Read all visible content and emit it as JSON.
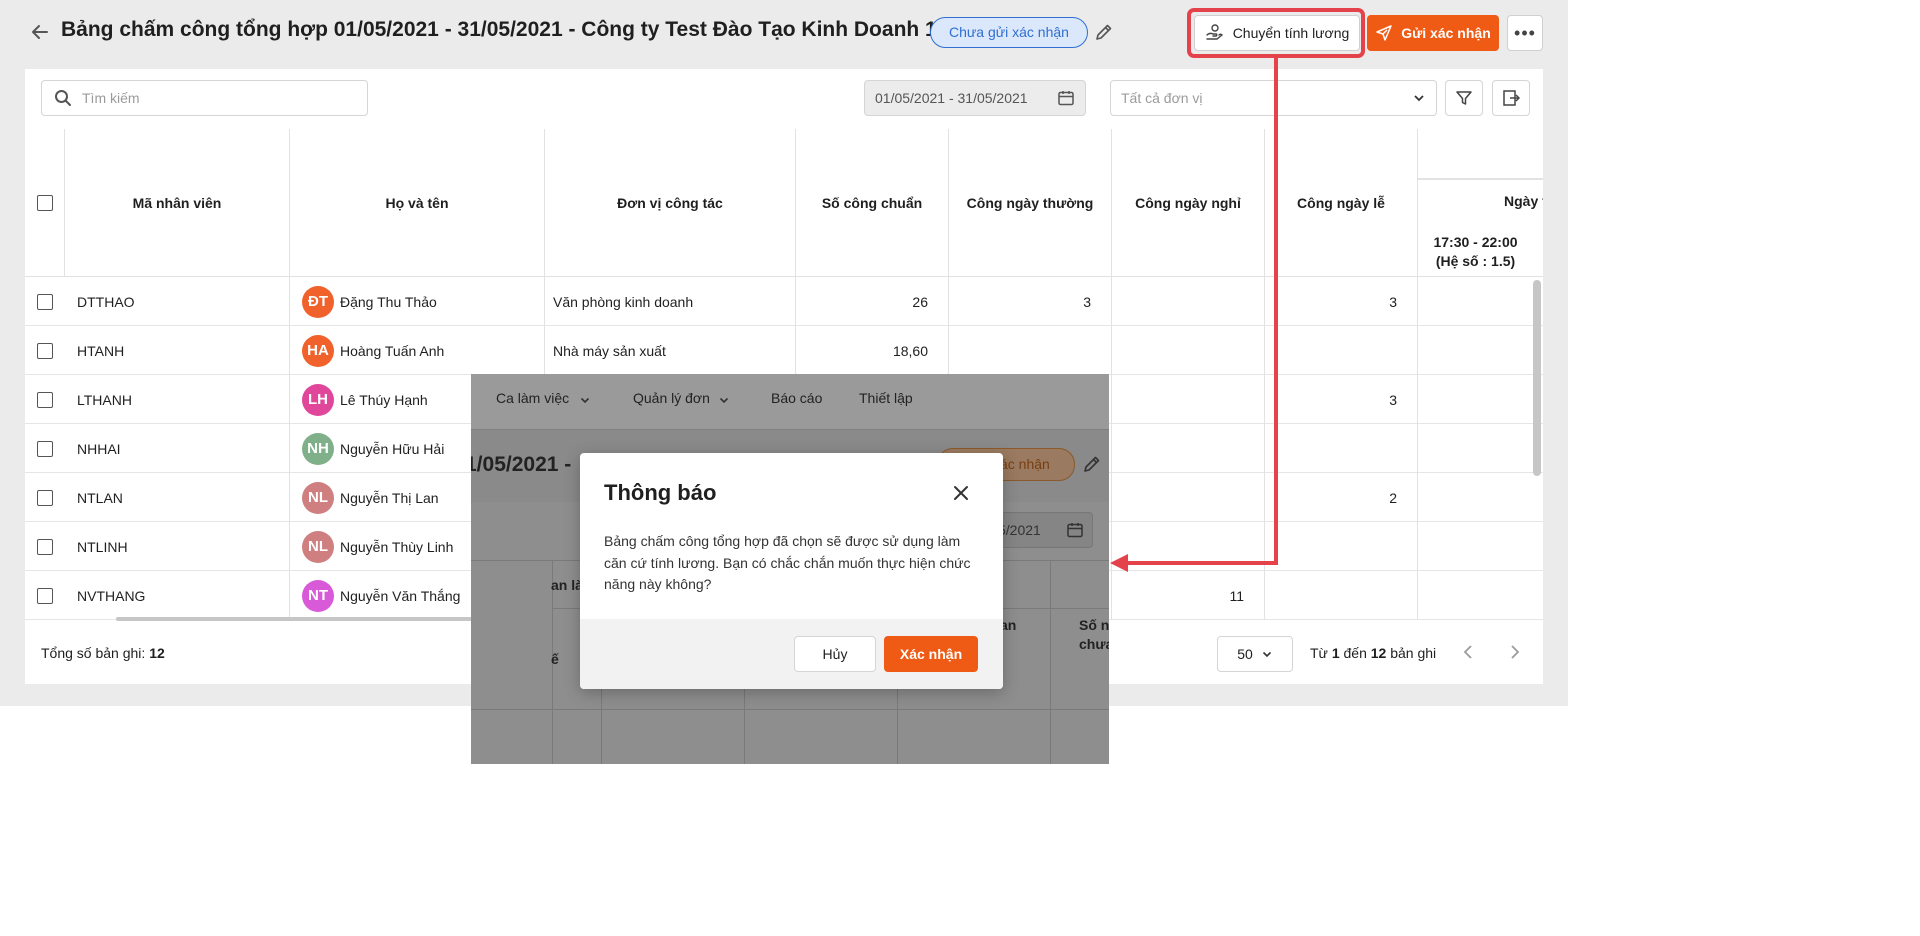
{
  "header": {
    "title": "Bảng chấm công tổng hợp 01/05/2021 - 31/05/2021 - Công ty Test Đào Tạo Kinh Doanh 1",
    "status": "Chưa gửi xác nhận",
    "transfer_label": "Chuyển tính lương",
    "send_label": "Gửi xác nhận",
    "more_label": "•••"
  },
  "toolbar": {
    "search_placeholder": "Tìm kiếm",
    "date_range": "01/05/2021 - 31/05/2021",
    "unit_placeholder": "Tất cả đơn vị"
  },
  "table": {
    "columns": [
      "Mã nhân viên",
      "Họ và tên",
      "Đơn vị công tác",
      "Số công chuẩn",
      "Công ngày thường",
      "Công ngày nghỉ",
      "Công ngày lễ"
    ],
    "group_header": "Ngày t",
    "sub_header_line1": "17:30 - 22:00",
    "sub_header_line2": "(Hệ số : 1.5)",
    "rows": [
      {
        "code": "DTTHAO",
        "initials": "ĐT",
        "color": "#f0612b",
        "name": "Đặng Thu Thảo",
        "unit": "Văn phòng kinh doanh",
        "standard": "26",
        "normal": "3",
        "off": "",
        "holiday": "3"
      },
      {
        "code": "HTANH",
        "initials": "HA",
        "color": "#f0612b",
        "name": "Hoàng Tuấn Anh",
        "unit": "Nhà máy sản xuất",
        "standard": "18,60",
        "normal": "",
        "off": "",
        "holiday": ""
      },
      {
        "code": "LTHANH",
        "initials": "LH",
        "color": "#e0469a",
        "name": "Lê Thúy Hạnh",
        "unit": "",
        "standard": "",
        "normal": "",
        "off": "",
        "holiday": "3"
      },
      {
        "code": "NHHAI",
        "initials": "NH",
        "color": "#7fb08a",
        "name": "Nguyễn Hữu Hải",
        "unit": "",
        "standard": "",
        "normal": "",
        "off": "",
        "holiday": ""
      },
      {
        "code": "NTLAN",
        "initials": "NL",
        "color": "#cf7f7f",
        "name": "Nguyễn Thị Lan",
        "unit": "",
        "standard": "",
        "normal": "",
        "off": "",
        "holiday": "2"
      },
      {
        "code": "NTLINH",
        "initials": "NL",
        "color": "#cf7f7f",
        "name": "Nguyễn Thùy Linh",
        "unit": "",
        "standard": "",
        "normal": "",
        "off": "",
        "holiday": ""
      },
      {
        "code": "NVTHANG",
        "initials": "NT",
        "color": "#d95ad9",
        "name": "Nguyễn Văn Thắng",
        "unit": "",
        "standard": "",
        "normal": "",
        "off": "11",
        "holiday": ""
      }
    ]
  },
  "footer": {
    "total_label": "Tổng số bản ghi:",
    "total_value": "12",
    "page_size": "50",
    "range_from_label": "Từ",
    "range_from": "1",
    "range_to_label": "đến",
    "range_to": "12",
    "range_suffix": "bản ghi"
  },
  "background_screenshot": {
    "nav": [
      "Ca làm việc",
      "Quản lý đơn",
      "Báo cáo",
      "Thiết lập"
    ],
    "title_fragment": "1/05/2021 -",
    "badge_fragment": "ác nhận",
    "date_fragment": "5/2021",
    "col_fragment_1": "an là",
    "col_fragment_2": "ế",
    "col_fragment_3": "an",
    "col_fragment_4a": "Số n",
    "col_fragment_4b": "chưa"
  },
  "modal": {
    "title": "Thông báo",
    "body": "Bảng chấm công tổng hợp đã chọn sẽ được sử dụng làm căn cứ tính lương. Bạn có chắc chắn muốn thực hiện chức năng này không?",
    "cancel_label": "Hủy",
    "confirm_label": "Xác nhận"
  },
  "colors": {
    "accent": "#ef5a14",
    "status_blue": "#2f6fd1",
    "highlight_red": "#e4434c"
  }
}
